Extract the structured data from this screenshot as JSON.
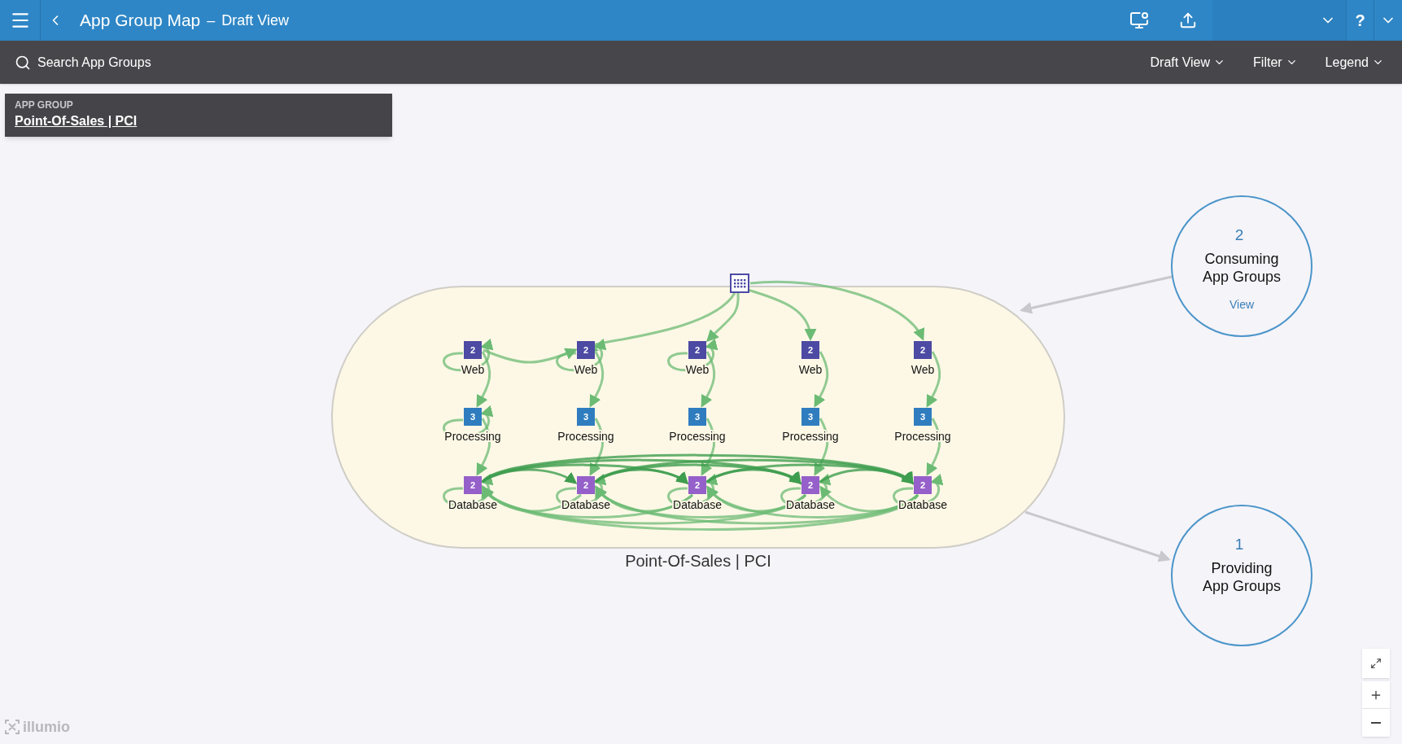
{
  "header": {
    "title": "App Group Map",
    "separator": "–",
    "subtitle": "Draft View",
    "help": "?"
  },
  "toolbar": {
    "search_placeholder": "Search App Groups",
    "menus": [
      "Draft View",
      "Filter",
      "Legend"
    ]
  },
  "app_group_card": {
    "heading": "APP GROUP",
    "name": "Point-Of-Sales | PCI"
  },
  "group": {
    "label": "Point-Of-Sales | PCI",
    "columns": [
      {
        "tiers": [
          {
            "kind": "web",
            "count": "2",
            "label": "Web"
          },
          {
            "kind": "processing",
            "count": "3",
            "label": "Processing"
          },
          {
            "kind": "database",
            "count": "2",
            "label": "Database"
          }
        ]
      },
      {
        "tiers": [
          {
            "kind": "web",
            "count": "2",
            "label": "Web"
          },
          {
            "kind": "processing",
            "count": "3",
            "label": "Processing"
          },
          {
            "kind": "database",
            "count": "2",
            "label": "Database"
          }
        ]
      },
      {
        "tiers": [
          {
            "kind": "web",
            "count": "2",
            "label": "Web"
          },
          {
            "kind": "processing",
            "count": "3",
            "label": "Processing"
          },
          {
            "kind": "database",
            "count": "2",
            "label": "Database"
          }
        ]
      },
      {
        "tiers": [
          {
            "kind": "web",
            "count": "2",
            "label": "Web"
          },
          {
            "kind": "processing",
            "count": "3",
            "label": "Processing"
          },
          {
            "kind": "database",
            "count": "2",
            "label": "Database"
          }
        ]
      },
      {
        "tiers": [
          {
            "kind": "web",
            "count": "2",
            "label": "Web"
          },
          {
            "kind": "processing",
            "count": "3",
            "label": "Processing"
          },
          {
            "kind": "database",
            "count": "2",
            "label": "Database"
          }
        ]
      }
    ]
  },
  "summary_circles": [
    {
      "kind": "consuming",
      "count": "2",
      "label_lines": [
        "Consuming",
        "App Groups"
      ],
      "link": "View"
    },
    {
      "kind": "providing",
      "count": "1",
      "label_lines": [
        "Providing",
        "App Groups"
      ]
    }
  ],
  "brand": "illumio"
}
